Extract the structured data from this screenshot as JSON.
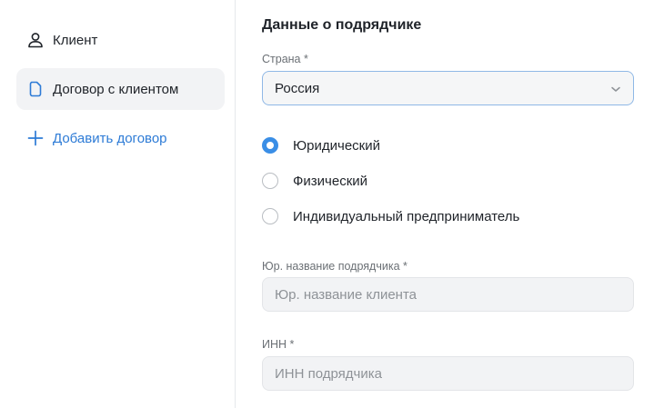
{
  "sidebar": {
    "client_label": "Клиент",
    "contract_label": "Договор с клиентом",
    "add_label": "Добавить договор"
  },
  "form": {
    "title": "Данные о подрядчике",
    "country_label": "Страна *",
    "country_value": "Россия",
    "entity_types": [
      {
        "label": "Юридический",
        "checked": true
      },
      {
        "label": "Физический",
        "checked": false
      },
      {
        "label": "Индивидуальный предприниматель",
        "checked": false
      }
    ],
    "legal_name_label": "Юр. название подрядчика *",
    "legal_name_placeholder": "Юр. название клиента",
    "inn_label": "ИНН *",
    "inn_placeholder": "ИНН подрядчика"
  },
  "colors": {
    "accent": "#3a8ee6",
    "link": "#2d7bd6",
    "select_border": "#8fb8e6"
  },
  "icons": {
    "client": "person-icon",
    "contract": "document-icon",
    "add": "plus-icon",
    "select": "chevron-down-icon"
  }
}
